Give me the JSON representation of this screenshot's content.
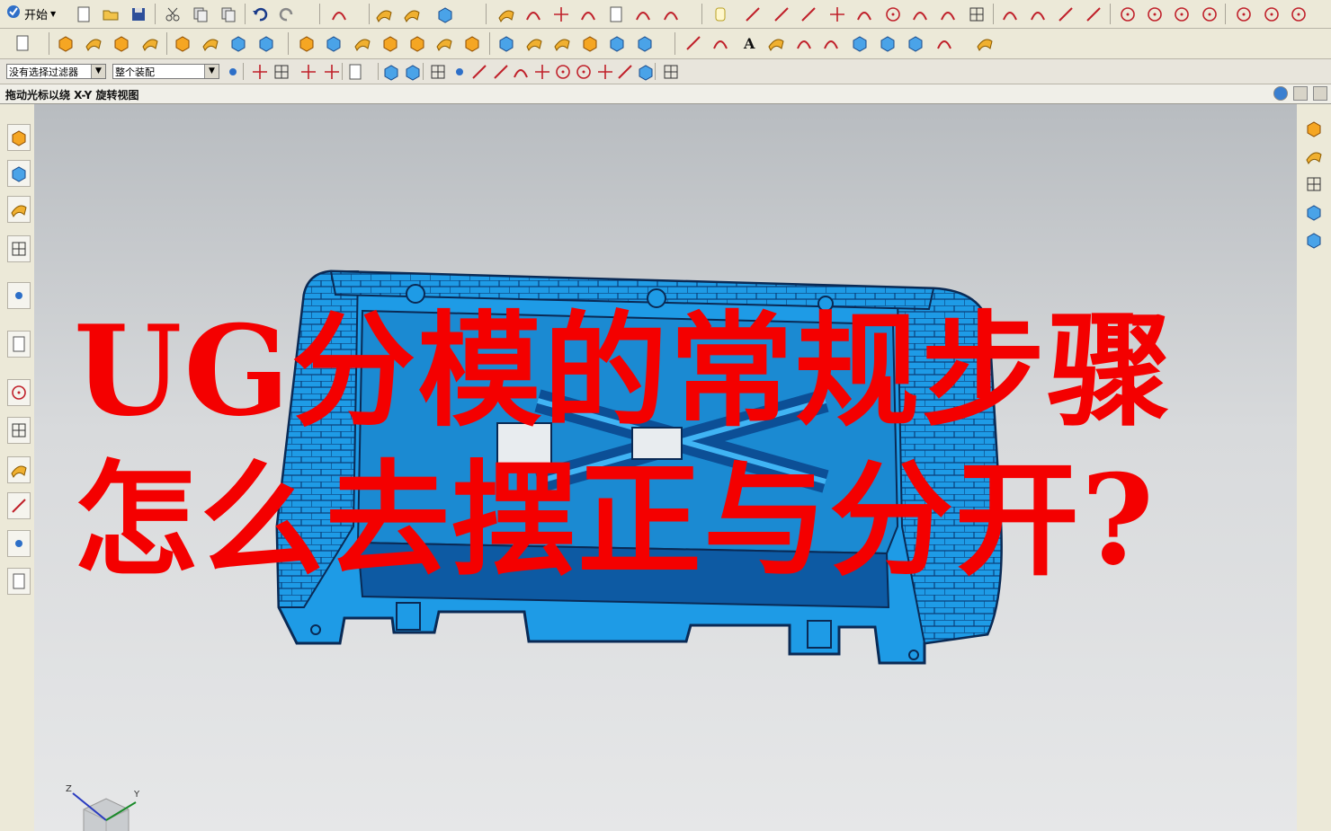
{
  "toolbar": {
    "start_label": "开始",
    "selection_filter": "没有选择过滤器",
    "assembly_scope": "整个装配"
  },
  "cue_line": {
    "text": "拖动光标以绕 X-Y 旋转视图"
  },
  "overlay": {
    "line1": "UG分模的常规步骤",
    "line2": "怎么去摆正与分开?"
  },
  "triad": {
    "z_label": "Z",
    "y_label": "Y"
  },
  "colors": {
    "overlay_text": "#f40000",
    "part_fill": "#1e9be6",
    "part_edge": "#0a2a55",
    "viewport_top": "#b8bcc0",
    "viewport_bottom": "#e6e7e8"
  },
  "icons": {
    "left_rail": [
      "assembly-navigator-icon",
      "constraint-navigator-icon",
      "part-navigator-icon",
      "reuse-library-icon",
      "info-icon",
      "web-browser-icon",
      "history-icon",
      "system-materials-icon",
      "process-studio-icon",
      "manufacturing-wizard-icon",
      "roles-icon",
      "reports-icon"
    ],
    "right_rail": [
      "mold-wizard-icon",
      "surface-icon",
      "layer-icon",
      "cylinder-icon",
      "pipe-icon"
    ]
  }
}
